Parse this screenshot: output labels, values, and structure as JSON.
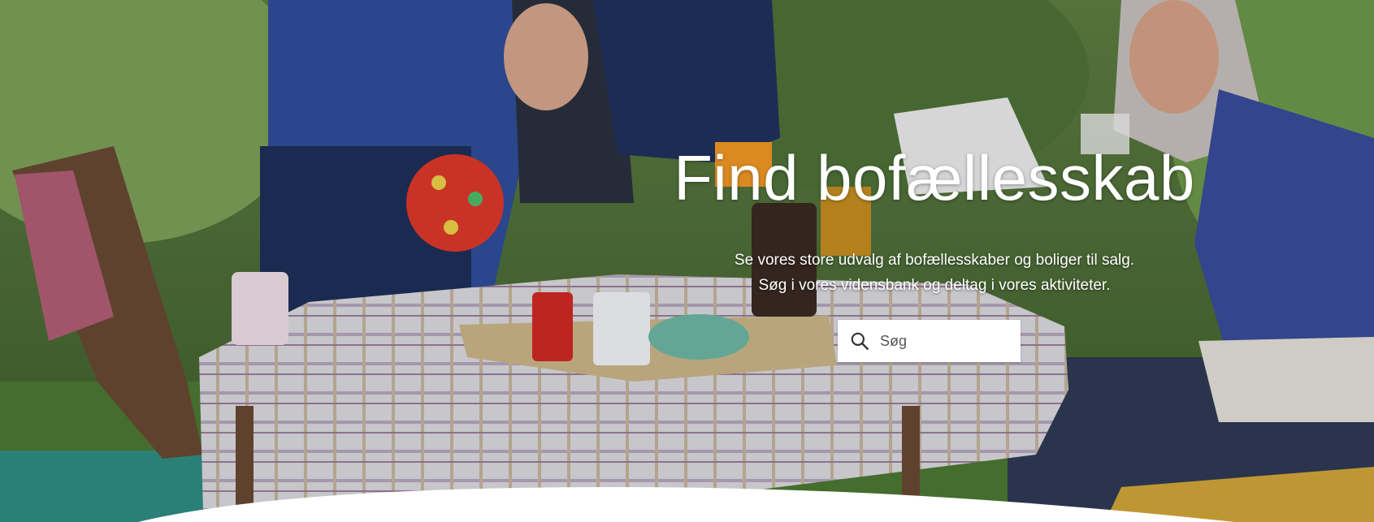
{
  "hero": {
    "title": "Find bofællesskab",
    "subtitle_line1": "Se vores store udvalg af bofællesskaber og boliger til salg.",
    "subtitle_line2": "Søg i vores vidensbank og deltag i vores aktiviteter."
  },
  "search": {
    "placeholder": "Søg",
    "icon": "search-icon"
  },
  "colors": {
    "text": "#ffffff",
    "search_bg": "#ffffff",
    "curve": "#ffffff"
  }
}
